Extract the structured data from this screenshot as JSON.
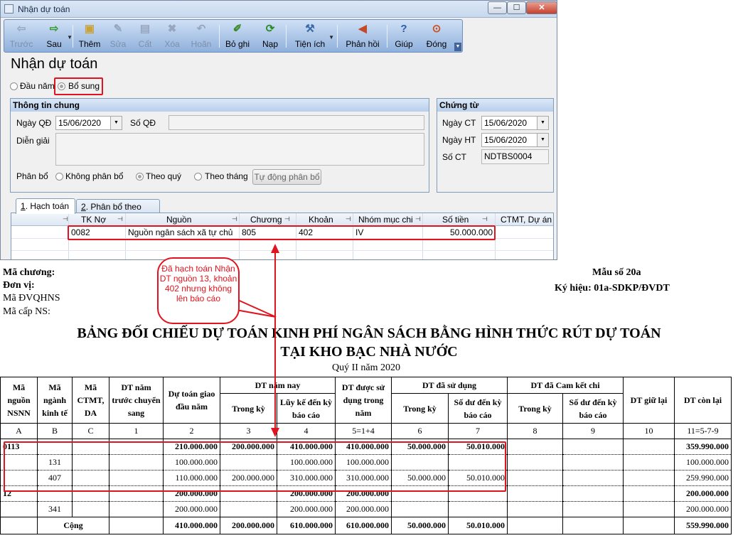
{
  "window": {
    "title": "Nhận dự toán",
    "controls": [
      "—",
      "☐",
      "✕"
    ]
  },
  "toolbar": {
    "buttons": [
      {
        "label": "Trước",
        "icon": "back-arrow-icon",
        "enabled": false
      },
      {
        "label": "Sau",
        "icon": "forward-arrow-icon",
        "enabled": true
      },
      {
        "label": "Thêm",
        "icon": "add-document-icon",
        "enabled": true
      },
      {
        "label": "Sửa",
        "icon": "edit-icon",
        "enabled": false
      },
      {
        "label": "Cất",
        "icon": "save-disk-icon",
        "enabled": false
      },
      {
        "label": "Xóa",
        "icon": "delete-icon",
        "enabled": false
      },
      {
        "label": "Hoãn",
        "icon": "undo-icon",
        "enabled": false
      },
      {
        "label": "Bỏ ghi",
        "icon": "unpost-pen-icon",
        "enabled": true
      },
      {
        "label": "Nạp",
        "icon": "refresh-icon",
        "enabled": true
      },
      {
        "label": "Tiện ích",
        "icon": "tools-icon",
        "enabled": true
      },
      {
        "label": "Phản hồi",
        "icon": "megaphone-icon",
        "enabled": true
      },
      {
        "label": "Giúp",
        "icon": "help-icon",
        "enabled": true
      },
      {
        "label": "Đóng",
        "icon": "close-icon",
        "enabled": true
      }
    ]
  },
  "form": {
    "heading": "Nhận dự toán",
    "type_options": [
      "Đầu năm",
      "Bổ sung"
    ],
    "type_selected": "Bổ sung",
    "general": {
      "title": "Thông tin chung",
      "ngay_qd_label": "Ngày QĐ",
      "ngay_qd_value": "15/06/2020",
      "so_qd_label": "Số QĐ",
      "so_qd_value": "",
      "dien_giai_label": "Diễn giải",
      "dien_giai_value": "",
      "phan_bo_label": "Phân bổ",
      "phan_bo_options": [
        "Không phân bổ",
        "Theo quý",
        "Theo tháng"
      ],
      "phan_bo_selected": "Theo quý",
      "auto_button": "Tự động phân bổ"
    },
    "voucher": {
      "title": "Chứng từ",
      "ngay_ct_label": "Ngày CT",
      "ngay_ct_value": "15/06/2020",
      "ngay_ht_label": "Ngày HT",
      "ngay_ht_value": "15/06/2020",
      "so_ct_label": "Số CT",
      "so_ct_value": "NDTBS0004"
    },
    "tabs": [
      {
        "key": "1",
        "label": ". Hạch toán"
      },
      {
        "key": "2",
        "label": ". Phân bổ theo quý"
      }
    ],
    "grid": {
      "columns": [
        "TK Nợ",
        "Nguồn",
        "Chương",
        "Khoản",
        "Nhóm mục chi",
        "Số tiền",
        "CTMT, Dự án"
      ],
      "row": {
        "tk_no": "0082",
        "nguon": "Nguồn ngân sách xã tự chủ",
        "chuong": "805",
        "khoan": "402",
        "nhom_muc_chi": "IV",
        "so_tien": "50.000.000",
        "ctmt": ""
      }
    }
  },
  "callout": {
    "text": "Đã hạch toán Nhận DT nguồn 13, khoản 402 nhưng không lên báo cáo"
  },
  "report": {
    "header_left": {
      "ma_chuong": "Mã chương:",
      "don_vi": "Đơn vị:",
      "ma_dvqhns": "Mã ĐVQHNS",
      "ma_cap_ns": "Mã cấp NS:"
    },
    "header_right": {
      "mau_so": "Mẫu số 20a",
      "ky_hieu": "Ký hiệu: 01a-SDKP/ĐVDT"
    },
    "title_line1": "BẢNG ĐỐI CHIẾU DỰ TOÁN KINH PHÍ NGÂN SÁCH BẰNG HÌNH THỨC RÚT DỰ TOÁN",
    "title_line2": "TẠI KHO BẠC NHÀ NƯỚC",
    "period": "Quý II năm 2020",
    "col_headers": {
      "ma_nguon": "Mã nguồn NSNN",
      "ma_nganh": "Mã ngành kinh tế",
      "ma_ctmt": "Mã CTMT, DA",
      "dt_nam_truoc": "DT năm trước chuyển sang",
      "dt_giao": "Dự toán giao đầu năm",
      "dt_nam_nay": "DT năm nay",
      "trong_ky": "Trong kỳ",
      "luy_ke": "Lũy kế đến kỳ báo cáo",
      "dt_duoc_su_dung": "DT được sử dụng trong năm",
      "dt_da_su_dung": "DT đã sử dụng",
      "so_du": "Số dư đến kỳ báo cáo",
      "dt_cam_ket": "DT đã Cam kết chi",
      "dt_giu_lai": "DT giữ lại",
      "dt_con_lai": "DT còn lại"
    },
    "col_codes": [
      "A",
      "B",
      "C",
      "1",
      "2",
      "3",
      "4",
      "5=1+4",
      "6",
      "7",
      "8",
      "9",
      "10",
      "11=5-7-9"
    ],
    "rows": [
      {
        "a": "0113",
        "b": "",
        "c": "",
        "v1": "",
        "v2": "210.000.000",
        "v3": "200.000.000",
        "v4": "410.000.000",
        "v5": "410.000.000",
        "v6": "50.000.000",
        "v7": "50.010.000",
        "v8": "",
        "v9": "",
        "v10": "",
        "v11": "359.990.000",
        "bold": true
      },
      {
        "a": "",
        "b": "131",
        "c": "",
        "v1": "",
        "v2": "100.000.000",
        "v3": "",
        "v4": "100.000.000",
        "v5": "100.000.000",
        "v6": "",
        "v7": "",
        "v8": "",
        "v9": "",
        "v10": "",
        "v11": "100.000.000",
        "bold": false
      },
      {
        "a": "",
        "b": "407",
        "c": "",
        "v1": "",
        "v2": "110.000.000",
        "v3": "200.000.000",
        "v4": "310.000.000",
        "v5": "310.000.000",
        "v6": "50.000.000",
        "v7": "50.010.000",
        "v8": "",
        "v9": "",
        "v10": "",
        "v11": "259.990.000",
        "bold": false
      },
      {
        "a": "12",
        "b": "",
        "c": "",
        "v1": "",
        "v2": "200.000.000",
        "v3": "",
        "v4": "200.000.000",
        "v5": "200.000.000",
        "v6": "",
        "v7": "",
        "v8": "",
        "v9": "",
        "v10": "",
        "v11": "200.000.000",
        "bold": true
      },
      {
        "a": "",
        "b": "341",
        "c": "",
        "v1": "",
        "v2": "200.000.000",
        "v3": "",
        "v4": "200.000.000",
        "v5": "200.000.000",
        "v6": "",
        "v7": "",
        "v8": "",
        "v9": "",
        "v10": "",
        "v11": "200.000.000",
        "bold": false
      }
    ],
    "total": {
      "label": "Cộng",
      "v2": "410.000.000",
      "v3": "200.000.000",
      "v4": "610.000.000",
      "v5": "610.000.000",
      "v6": "50.000.000",
      "v7": "50.010.000",
      "v8": "",
      "v9": "",
      "v10": "",
      "v11": "559.990.000"
    }
  },
  "colors": {
    "annotation": "#e0141e",
    "toolbar": "#8fb0dc"
  }
}
